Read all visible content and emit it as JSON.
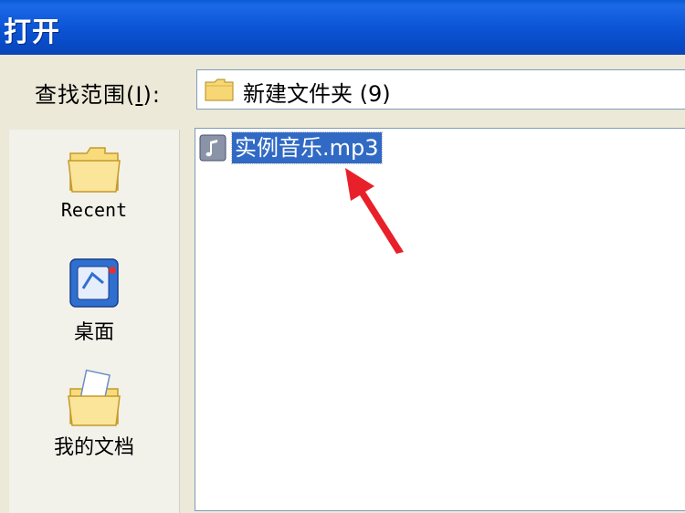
{
  "window": {
    "title": "打开"
  },
  "lookin": {
    "label_prefix": "查找范围(",
    "label_accel": "I",
    "label_suffix": "):",
    "value": "新建文件夹 (9)"
  },
  "places": [
    {
      "label": "Recent",
      "icon": "recent-folder-icon"
    },
    {
      "label": "桌面",
      "icon": "desktop-icon"
    },
    {
      "label": "我的文档",
      "icon": "my-documents-icon"
    }
  ],
  "files": [
    {
      "name": "实例音乐.mp3",
      "icon": "audio-file-icon",
      "selected": true
    }
  ],
  "colors": {
    "titlebar": "#0a55d6",
    "selection": "#316ac5",
    "annotation_arrow": "#e8202a"
  }
}
